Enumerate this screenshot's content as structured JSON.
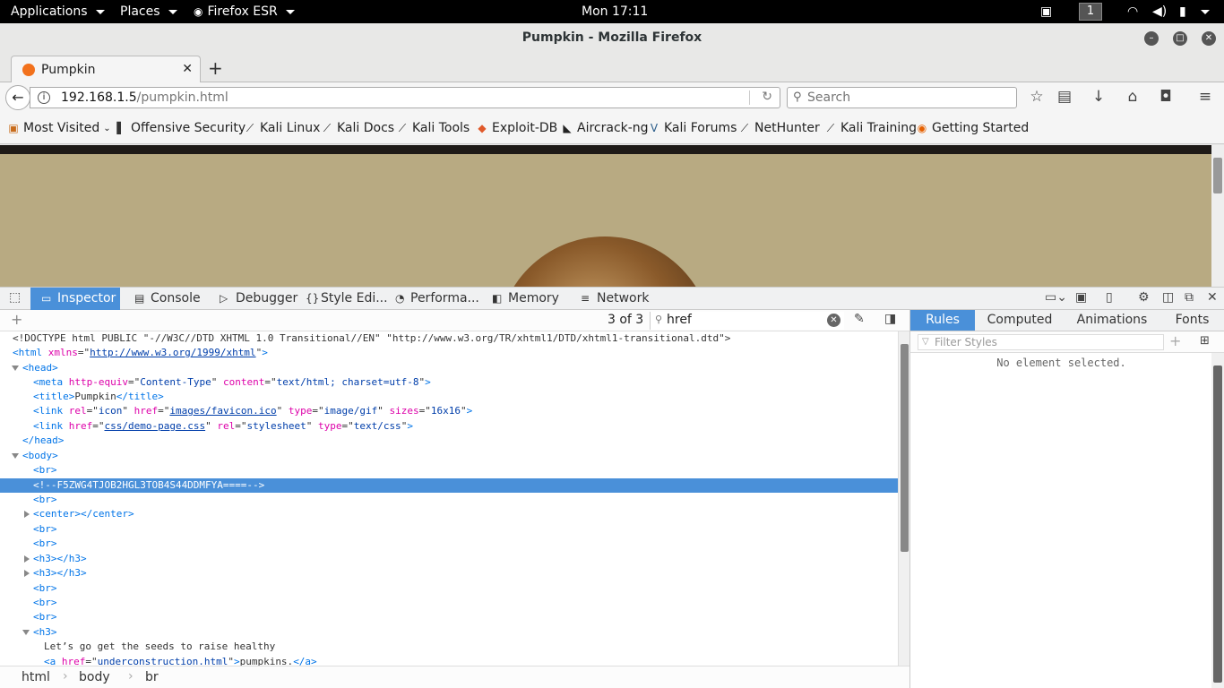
{
  "topbar": {
    "applications": "Applications",
    "places": "Places",
    "firefox_esr": "Firefox ESR",
    "clock": "Mon 17:11",
    "workspace": "1"
  },
  "window": {
    "title": "Pumpkin - Mozilla Firefox",
    "minimize_icon": "–",
    "maximize_icon": "□",
    "close_icon": "✕"
  },
  "tabs": [
    {
      "label": "Pumpkin",
      "close": "✕"
    }
  ],
  "newtab": "+",
  "nav": {
    "url_host": "192.168.1.5",
    "url_path": "/pumpkin.html",
    "search_placeholder": "Search"
  },
  "bookmarks": [
    {
      "label": "Most Visited",
      "icon": "folder-icon"
    },
    {
      "label": "Offensive Security",
      "icon": "offsec-icon"
    },
    {
      "label": "Kali Linux",
      "icon": "kali-icon"
    },
    {
      "label": "Kali Docs",
      "icon": "kali-icon"
    },
    {
      "label": "Kali Tools",
      "icon": "kali-icon"
    },
    {
      "label": "Exploit-DB",
      "icon": "exploitdb-icon"
    },
    {
      "label": "Aircrack-ng",
      "icon": "aircrack-icon"
    },
    {
      "label": "Kali Forums",
      "icon": "kali-forums-icon"
    },
    {
      "label": "NetHunter",
      "icon": "kali-icon"
    },
    {
      "label": "Kali Training",
      "icon": "kali-icon"
    },
    {
      "label": "Getting Started",
      "icon": "firefox-icon"
    }
  ],
  "devtools": {
    "tabs": [
      "Inspector",
      "Console",
      "Debugger",
      "Style Edi...",
      "Performa...",
      "Memory",
      "Network"
    ],
    "search_count": "3 of 3",
    "search_value": "href",
    "side_tabs": [
      "Rules",
      "Computed",
      "Animations",
      "Fonts"
    ],
    "filter_placeholder": "Filter Styles",
    "no_selection": "No element selected.",
    "breadcrumbs": [
      "html",
      "body",
      "br"
    ],
    "markup": {
      "doctype": "<!DOCTYPE html PUBLIC \"-//W3C//DTD XHTML 1.0 Transitional//EN\" \"http://www.w3.org/TR/xhtml1/DTD/xhtml1-transitional.dtd\">",
      "html_xmlns": "http://www.w3.org/1999/xhtml",
      "meta_http_equiv": "Content-Type",
      "meta_content": "text/html; charset=utf-8",
      "title_text": "Pumpkin",
      "favicon_href": "images/favicon.ico",
      "favicon_type": "image/gif",
      "favicon_sizes": "16x16",
      "css_href": "css/demo-page.css",
      "css_rel": "stylesheet",
      "css_type": "text/css",
      "comment": "<!--F5ZWG4TJOB2HGL3TOB4S44DDMFYA====-->",
      "h3_text": "Let’s go get the seeds to raise healthy",
      "a_href": "underconstruction.html",
      "a_text": "pumpkins."
    }
  }
}
